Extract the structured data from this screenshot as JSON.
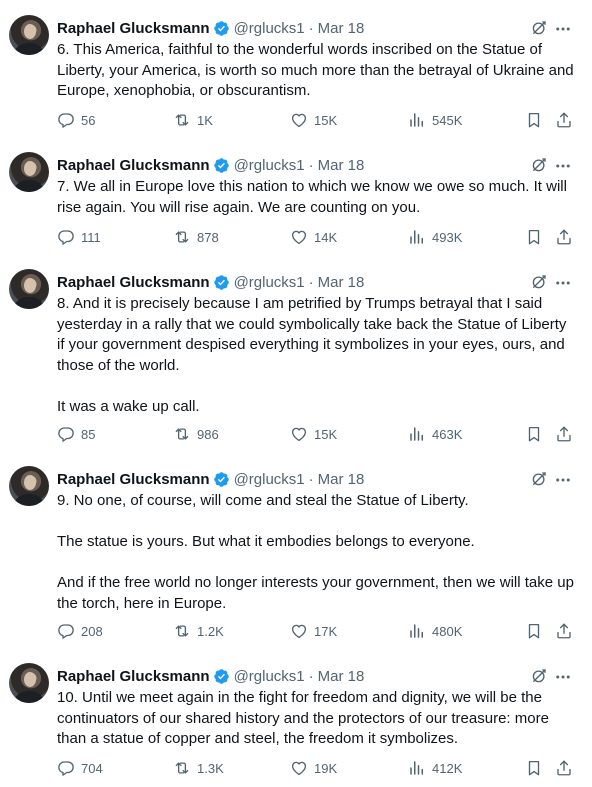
{
  "author": {
    "name": "Raphael Glucksmann",
    "handle": "@rglucks1",
    "date": "Mar 18",
    "separator": "·"
  },
  "tweets": [
    {
      "text": "6. This America, faithful to the wonderful words inscribed on the Statue of Liberty, your America, is worth so much more than the betrayal of Ukraine and Europe, xenophobia, or obscurantism.",
      "replies": "56",
      "retweets": "1K",
      "likes": "15K",
      "views": "545K"
    },
    {
      "text": "7. We all in Europe love this nation to which we know we owe so much. It will rise again. You will rise again. We are counting on you.",
      "replies": "111",
      "retweets": "878",
      "likes": "14K",
      "views": "493K"
    },
    {
      "text": "8. And it is precisely because I am petrified by Trumps betrayal that I said yesterday in a rally that we could symbolically take back the Statue of Liberty if your government despised everything it symbolizes in your eyes, ours, and those of the world.\n\nIt was a wake up call.",
      "replies": "85",
      "retweets": "986",
      "likes": "15K",
      "views": "463K"
    },
    {
      "text": "9. No one, of course, will come and steal the Statue of Liberty.\n\nThe statue is yours. But what it embodies belongs to everyone.\n\nAnd if the free world no longer interests your government, then we will take up the torch, here in Europe.",
      "replies": "208",
      "retweets": "1.2K",
      "likes": "17K",
      "views": "480K"
    },
    {
      "text": "10. Until we meet again in the fight for freedom and dignity, we will be the continuators of our shared history and the protectors of our treasure: more than a statue of copper and steel, the freedom it symbolizes.",
      "replies": "704",
      "retweets": "1.3K",
      "likes": "19K",
      "views": "412K"
    }
  ],
  "icons": {
    "verified": "verified-badge-icon",
    "grok": "grok-icon",
    "more": "more-icon",
    "reply": "reply-icon",
    "retweet": "retweet-icon",
    "like": "heart-icon",
    "views": "views-icon",
    "bookmark": "bookmark-icon",
    "share": "share-icon"
  },
  "colors": {
    "text": "#0f1419",
    "secondary": "#536471",
    "verified": "#1d9bf0",
    "divider": "#eff3f4"
  }
}
